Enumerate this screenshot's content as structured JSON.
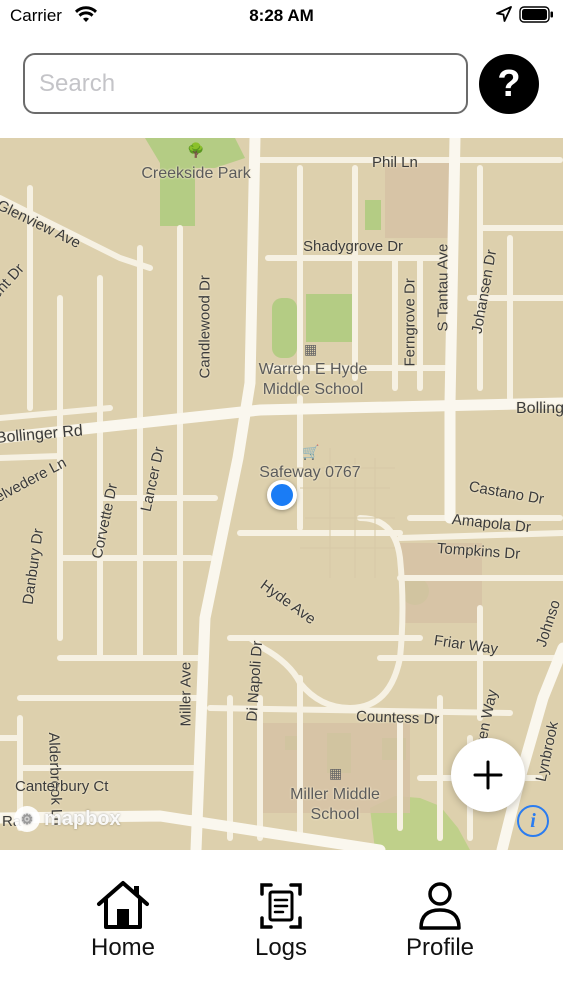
{
  "status_bar": {
    "carrier": "Carrier",
    "time": "8:28 AM"
  },
  "search": {
    "placeholder": "Search",
    "value": ""
  },
  "help_button": {
    "label": "?"
  },
  "map": {
    "street_labels": {
      "phil_ln": "Phil Ln",
      "glenview_ave": "Glenview Ave",
      "ent_dr": "ent Dr",
      "candlewood_dr": "Candlewood Dr",
      "shadygrove_dr": "Shadygrove Dr",
      "ferngrove_dr": "Ferngrove Dr",
      "s_tantau_ave": "S Tantau Ave",
      "johansen_dr": "Johansen Dr",
      "bollinger_rd": "Bollinger Rd",
      "bolling": "Bolling",
      "velvedere_ln": "elvedere Ln",
      "lancer_dr": "Lancer Dr",
      "corvette_dr": "Corvette Dr",
      "danbury_dr": "Danbury Dr",
      "castano_dr": "Castano Dr",
      "amapola_dr": "Amapola Dr",
      "tompkins_dr": "Tompkins Dr",
      "hyde_ave": "Hyde Ave",
      "friar_way": "Friar Way",
      "johnson": "Johnso",
      "alderbrook_ln": "Alderbrook Ln",
      "miller_ave": "Miller Ave",
      "di_napoli_dr": "Di Napoli Dr",
      "countess_dr": "Countess Dr",
      "raven_way": "aven Way",
      "lynbrook": "Lynbrook",
      "canterbury_ct": "Canterbury Ct",
      "ra_partial": "Ra"
    },
    "pois": {
      "creekside_park": "Creekside Park",
      "warren_school": "Warren E Hyde\nMiddle School",
      "safeway": "Safeway 0767",
      "miller_school": "Miller Middle\nSchool"
    },
    "attribution": "mapbox",
    "colors": {
      "land": "#ddd0ad",
      "road": "#f6f1e3",
      "park": "#b4cc84",
      "user_location": "#1a7cf5"
    }
  },
  "tabs": [
    {
      "label": "Home",
      "icon": "home-icon"
    },
    {
      "label": "Logs",
      "icon": "logs-icon"
    },
    {
      "label": "Profile",
      "icon": "profile-icon"
    }
  ]
}
